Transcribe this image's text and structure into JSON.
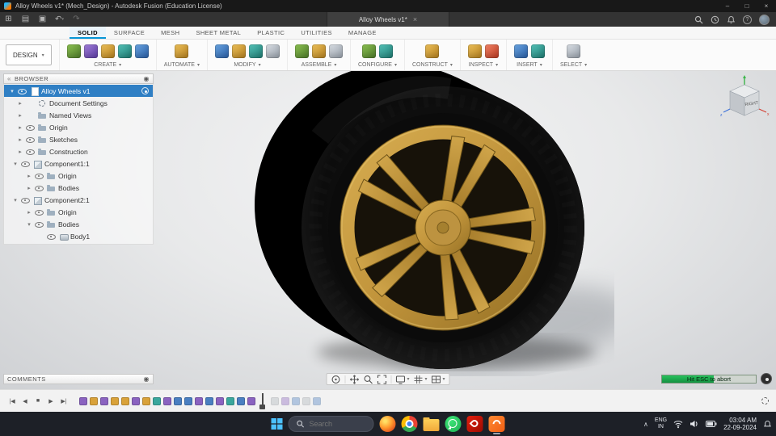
{
  "colors": {
    "accent_blue": "#0696d7",
    "selection_blue": "#2f7fc4",
    "progress_green": "#1fa84d",
    "rim_gold": "#c79a42",
    "tire_black": "#0b0b0b",
    "fusion_orange": "#f05e13"
  },
  "icons": {
    "tri_down": "▾",
    "tri_right": "▸",
    "caret": "▾",
    "target": "◉",
    "collapse": "«",
    "grid": "⊞",
    "list": "▤",
    "save": "▣",
    "undo": "↶",
    "redo": "↷",
    "close": "×",
    "minimize": "–",
    "maximize": "□",
    "chevron_up": "∧",
    "help": "?"
  },
  "title_bar": {
    "title": "Alloy Wheels v1* (Mech_Design) - Autodesk Fusion (Education License)"
  },
  "app_bar": {
    "tab_label": "Alloy Wheels v1*"
  },
  "ribbon": {
    "design_button": "DESIGN",
    "tabs": [
      {
        "label": "SOLID",
        "cls": "active"
      },
      {
        "label": "SURFACE",
        "cls": ""
      },
      {
        "label": "MESH",
        "cls": ""
      },
      {
        "label": "SHEET METAL",
        "cls": ""
      },
      {
        "label": "PLASTIC",
        "cls": ""
      },
      {
        "label": "UTILITIES",
        "cls": ""
      },
      {
        "label": "MANAGE",
        "cls": ""
      }
    ],
    "groups": [
      {
        "label": "CREATE"
      },
      {
        "label": "AUTOMATE"
      },
      {
        "label": "MODIFY"
      },
      {
        "label": "ASSEMBLE"
      },
      {
        "label": "CONFIGURE"
      },
      {
        "label": "CONSTRUCT"
      },
      {
        "label": "INSPECT"
      },
      {
        "label": "INSERT"
      },
      {
        "label": "SELECT"
      }
    ]
  },
  "browser": {
    "header": "BROWSER",
    "root_label": "Alloy Wheels v1",
    "items": [
      {
        "label": "Document Settings",
        "pad": "16px",
        "expander": "▸",
        "eyecls": "hide",
        "iconcls": "gear"
      },
      {
        "label": "Named Views",
        "pad": "16px",
        "expander": "▸",
        "eyecls": "hide",
        "iconcls": "folder"
      },
      {
        "label": "Origin",
        "pad": "16px",
        "expander": "▸",
        "eyecls": "",
        "iconcls": "folder"
      },
      {
        "label": "Sketches",
        "pad": "16px",
        "expander": "▸",
        "eyecls": "",
        "iconcls": "folder"
      },
      {
        "label": "Construction",
        "pad": "16px",
        "expander": "▸",
        "eyecls": "",
        "iconcls": "folder"
      },
      {
        "label": "Component1:1",
        "pad": "10px",
        "expander": "▾",
        "eyecls": "",
        "iconcls": "component"
      },
      {
        "label": "Origin",
        "pad": "27px",
        "expander": "▸",
        "eyecls": "",
        "iconcls": "folder"
      },
      {
        "label": "Bodies",
        "pad": "27px",
        "expander": "▸",
        "eyecls": "",
        "iconcls": "folder"
      },
      {
        "label": "Component2:1",
        "pad": "10px",
        "expander": "▾",
        "eyecls": "",
        "iconcls": "component"
      },
      {
        "label": "Origin",
        "pad": "27px",
        "expander": "▸",
        "eyecls": "",
        "iconcls": "folder"
      },
      {
        "label": "Bodies",
        "pad": "27px",
        "expander": "▾",
        "eyecls": "",
        "iconcls": "folder"
      },
      {
        "label": "Body1",
        "pad": "42px",
        "expander": "",
        "eyecls": "",
        "iconcls": "body"
      }
    ]
  },
  "viewcube": {
    "face": "RIGHT",
    "axis_x": "x",
    "axis_z": "z"
  },
  "viewport": {
    "comments_header": "COMMENTS",
    "progress": {
      "label": "Hit ESC to abort",
      "fill_width": "55%"
    }
  },
  "timeline": {
    "controls": [
      {
        "g": "|◀"
      },
      {
        "g": "◀"
      },
      {
        "g": "■"
      },
      {
        "g": "▶"
      },
      {
        "g": "▶|"
      }
    ],
    "features": [
      {
        "c": "#8a63c0",
        "cls": ""
      },
      {
        "c": "#d9a23a",
        "cls": ""
      },
      {
        "c": "#8a63c0",
        "cls": ""
      },
      {
        "c": "#d9a23a",
        "cls": ""
      },
      {
        "c": "#d9a23a",
        "cls": ""
      },
      {
        "c": "#8a63c0",
        "cls": ""
      },
      {
        "c": "#d9a23a",
        "cls": ""
      },
      {
        "c": "#3aa79d",
        "cls": ""
      },
      {
        "c": "#8a63c0",
        "cls": ""
      },
      {
        "c": "#4a7fc1",
        "cls": ""
      },
      {
        "c": "#4a7fc1",
        "cls": ""
      },
      {
        "c": "#8a63c0",
        "cls": ""
      },
      {
        "c": "#4a7fc1",
        "cls": ""
      },
      {
        "c": "#8a63c0",
        "cls": ""
      },
      {
        "c": "#3aa79d",
        "cls": ""
      },
      {
        "c": "#4a7fc1",
        "cls": ""
      },
      {
        "c": "#8a63c0",
        "cls": ""
      }
    ],
    "features_dim": [
      {
        "c": "#aeb4ba",
        "cls": "dim"
      },
      {
        "c": "#8a63c0",
        "cls": "dim"
      },
      {
        "c": "#4a7fc1",
        "cls": "dim"
      },
      {
        "c": "#aeb4ba",
        "cls": "dim"
      },
      {
        "c": "#4a7fc1",
        "cls": "dim"
      }
    ]
  },
  "taskbar": {
    "search": "Search",
    "lang_top": "ENG",
    "lang_bottom": "IN",
    "time": "03:04 AM",
    "date": "22-09-2024"
  }
}
